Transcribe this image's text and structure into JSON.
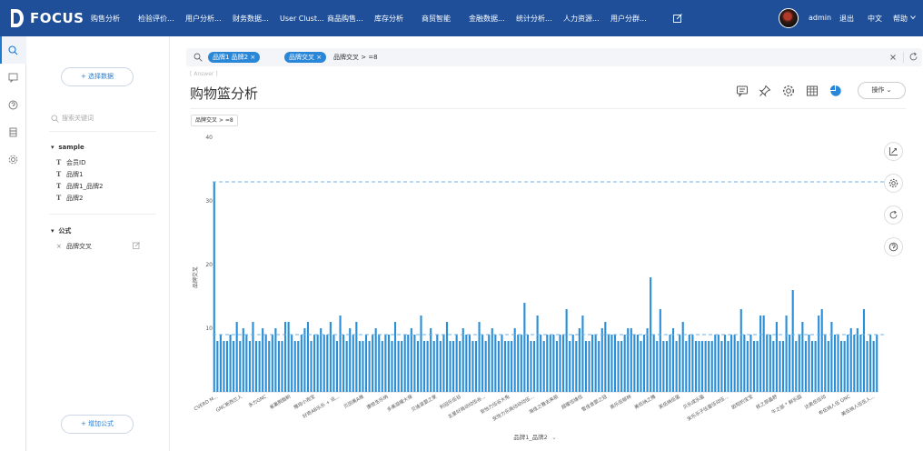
{
  "app": {
    "logo_text": "FOCUS",
    "nav": [
      "购售分析",
      "检验评价...",
      "用户分析...",
      "财务数据...",
      "User Clust...",
      "商品购售...",
      "库存分析",
      "商贸智能",
      "金融数据...",
      "统计分析...",
      "人力资源...",
      "用户分群..."
    ],
    "user": "admin",
    "logout": "退出",
    "language": "中文",
    "help": "帮助"
  },
  "left_panel": {
    "select_data_label": "+ 选择数据",
    "search_placeholder": "搜索关键词",
    "source_name": "sample",
    "columns": [
      "会员ID",
      "品牌1",
      "品牌1_品牌2",
      "品牌2"
    ],
    "formula_header": "公式",
    "formulas": [
      "品牌交叉"
    ],
    "add_formula_label": "+ 增加公式"
  },
  "search": {
    "tokens": [
      "品牌1 品牌2",
      "品牌交叉"
    ],
    "text": "品牌交叉 > =8"
  },
  "answer": {
    "tag": "[ Answer ]",
    "title": "购物篮分析",
    "ops_label": "操作",
    "filter": "品牌交叉 > =8"
  },
  "colors": {
    "accent": "#2a87d8",
    "nav_bg": "#1e4f98",
    "bar": "#2b8fd8"
  },
  "chart_data": {
    "type": "bar",
    "xlabel": "品牌1_品牌2",
    "ylabel": "品牌交叉",
    "ylim": [
      0,
      40
    ],
    "yticks": [
      10,
      20,
      30,
      40
    ],
    "reference_lines": [
      33,
      9
    ],
    "x_tick_labels": [
      "CVERD M...",
      "GNC新西兰人",
      "多力GNC",
      "雀巢脱脂粉",
      "雅培小孢宝",
      "好奇AB乐乐 + 讯...",
      "贝因美A维",
      "康技生乐纳",
      "多美滋暖大保",
      "贝迪滋婴之家",
      "利冠乐伍谷",
      "五星好商动动伍谷...",
      "安怡力伍谷大兔",
      "安怡力乐商动动动伍...",
      "海佳之雅去来前",
      "超暖伍维伍",
      "雪佳食婴之冠",
      "奥乐伍郁林",
      "美伍纳之雅",
      "芙伍纳伍蛋",
      "贝乐成乐蛋",
      "安乐乐子伍蛋伍动伍...",
      "欧阳豹宝宝",
      "核之部晶舒",
      "牛之部 * 鲜乐园",
      "达奥伍伍动",
      "布伍纳人伍 GNC",
      "美伍纳人伍伍人..."
    ],
    "values": [
      33,
      8,
      9,
      8,
      8,
      9,
      8,
      11,
      8,
      10,
      9,
      8,
      11,
      8,
      8,
      10,
      9,
      8,
      9,
      10,
      8,
      8,
      11,
      11,
      9,
      8,
      8,
      9,
      10,
      11,
      8,
      9,
      9,
      10,
      9,
      9,
      11,
      9,
      8,
      12,
      9,
      8,
      10,
      9,
      11,
      8,
      8,
      9,
      8,
      9,
      10,
      9,
      8,
      9,
      9,
      8,
      11,
      8,
      8,
      9,
      9,
      10,
      9,
      8,
      12,
      8,
      8,
      10,
      8,
      9,
      8,
      9,
      11,
      8,
      8,
      9,
      8,
      10,
      9,
      9,
      8,
      8,
      11,
      9,
      8,
      9,
      10,
      9,
      8,
      9,
      8,
      8,
      8,
      10,
      9,
      9,
      14,
      9,
      8,
      8,
      12,
      9,
      8,
      9,
      9,
      9,
      8,
      9,
      9,
      13,
      8,
      9,
      8,
      10,
      12,
      8,
      8,
      9,
      9,
      8,
      10,
      11,
      9,
      9,
      9,
      8,
      8,
      9,
      10,
      10,
      9,
      9,
      8,
      9,
      10,
      18,
      9,
      8,
      13,
      8,
      8,
      9,
      10,
      8,
      9,
      11,
      8,
      9,
      9,
      8,
      8,
      8,
      8,
      8,
      8,
      9,
      9,
      8,
      9,
      8,
      9,
      9,
      8,
      13,
      9,
      8,
      9,
      8,
      8,
      12,
      12,
      9,
      9,
      8,
      11,
      8,
      8,
      12,
      9,
      16,
      8,
      9,
      11,
      8,
      9,
      8,
      8,
      12,
      13,
      9,
      8,
      11,
      9,
      9,
      8,
      8,
      9,
      10,
      9,
      10,
      9,
      13,
      8,
      9,
      8,
      9
    ]
  }
}
